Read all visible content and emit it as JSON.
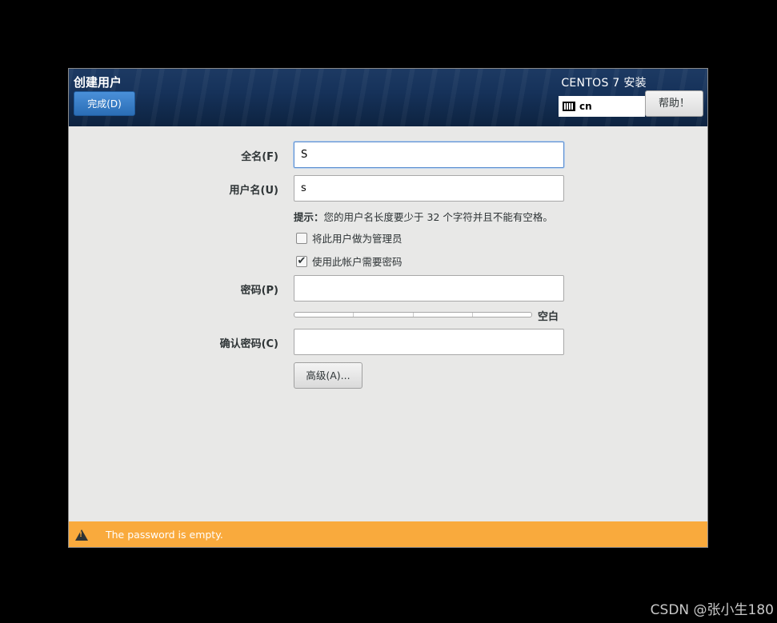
{
  "header": {
    "title": "创建用户",
    "done_label": "完成(D)",
    "product": "CENTOS 7 安装",
    "keyboard_layout": "cn",
    "help_label": "帮助！"
  },
  "form": {
    "fullname_label": "全名(F)",
    "fullname_value": "S",
    "username_label": "用户名(U)",
    "username_value": "s",
    "hint_prefix": "提示：",
    "hint_text": "您的用户名长度要少于 32 个字符并且不能有空格。",
    "admin_checkbox_label": "将此用户做为管理员",
    "admin_checked": false,
    "require_password_label": "使用此帐户需要密码",
    "require_password_checked": true,
    "password_label": "密码(P)",
    "password_value": "",
    "strength_level": 0,
    "strength_label": "空白",
    "confirm_label": "确认密码(C)",
    "confirm_value": "",
    "advanced_label": "高级(A)..."
  },
  "warning": {
    "text": "The password is empty."
  },
  "watermark": "CSDN @张小生180"
}
